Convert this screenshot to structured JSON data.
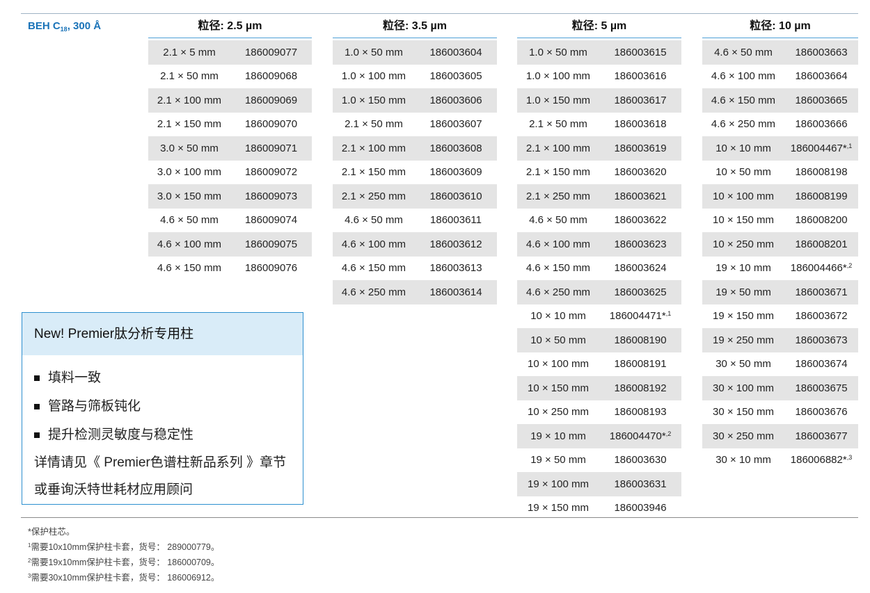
{
  "series": {
    "prefix": "BEH C",
    "sub": "18",
    "suffix": ", 300 Å"
  },
  "columns": [
    {
      "header": "粒径: 2.5 µm",
      "rows": [
        {
          "dim": "2.1 × 5 mm",
          "pn": "186009077",
          "note": ""
        },
        {
          "dim": "2.1 × 50 mm",
          "pn": "186009068",
          "note": ""
        },
        {
          "dim": "2.1 × 100 mm",
          "pn": "186009069",
          "note": ""
        },
        {
          "dim": "2.1 × 150 mm",
          "pn": "186009070",
          "note": ""
        },
        {
          "dim": "3.0 × 50 mm",
          "pn": "186009071",
          "note": ""
        },
        {
          "dim": "3.0 × 100 mm",
          "pn": "186009072",
          "note": ""
        },
        {
          "dim": "3.0 × 150 mm",
          "pn": "186009073",
          "note": ""
        },
        {
          "dim": "4.6 × 50 mm",
          "pn": "186009074",
          "note": ""
        },
        {
          "dim": "4.6 × 100 mm",
          "pn": "186009075",
          "note": ""
        },
        {
          "dim": "4.6 × 150 mm",
          "pn": "186009076",
          "note": ""
        }
      ]
    },
    {
      "header": "粒径: 3.5 µm",
      "rows": [
        {
          "dim": "1.0 × 50 mm",
          "pn": "186003604",
          "note": ""
        },
        {
          "dim": "1.0 × 100 mm",
          "pn": "186003605",
          "note": ""
        },
        {
          "dim": "1.0 × 150 mm",
          "pn": "186003606",
          "note": ""
        },
        {
          "dim": "2.1 × 50 mm",
          "pn": "186003607",
          "note": ""
        },
        {
          "dim": "2.1 × 100 mm",
          "pn": "186003608",
          "note": ""
        },
        {
          "dim": "2.1 × 150 mm",
          "pn": "186003609",
          "note": ""
        },
        {
          "dim": "2.1 × 250 mm",
          "pn": "186003610",
          "note": ""
        },
        {
          "dim": "4.6 × 50 mm",
          "pn": "186003611",
          "note": ""
        },
        {
          "dim": "4.6 × 100 mm",
          "pn": "186003612",
          "note": ""
        },
        {
          "dim": "4.6 × 150 mm",
          "pn": "186003613",
          "note": ""
        },
        {
          "dim": "4.6 × 250 mm",
          "pn": "186003614",
          "note": ""
        }
      ]
    },
    {
      "header": "粒径: 5 µm",
      "rows": [
        {
          "dim": "1.0 × 50 mm",
          "pn": "186003615",
          "note": ""
        },
        {
          "dim": "1.0 × 100 mm",
          "pn": "186003616",
          "note": ""
        },
        {
          "dim": "1.0 × 150 mm",
          "pn": "186003617",
          "note": ""
        },
        {
          "dim": "2.1 × 50 mm",
          "pn": "186003618",
          "note": ""
        },
        {
          "dim": "2.1 × 100 mm",
          "pn": "186003619",
          "note": ""
        },
        {
          "dim": "2.1 × 150 mm",
          "pn": "186003620",
          "note": ""
        },
        {
          "dim": "2.1 × 250 mm",
          "pn": "186003621",
          "note": ""
        },
        {
          "dim": "4.6 × 50 mm",
          "pn": "186003622",
          "note": ""
        },
        {
          "dim": "4.6 × 100 mm",
          "pn": "186003623",
          "note": ""
        },
        {
          "dim": "4.6 × 150 mm",
          "pn": "186003624",
          "note": ""
        },
        {
          "dim": "4.6 × 250 mm",
          "pn": "186003625",
          "note": ""
        },
        {
          "dim": "10 × 10 mm",
          "pn": "186004471*",
          "note": ",1"
        },
        {
          "dim": "10 × 50 mm",
          "pn": "186008190",
          "note": ""
        },
        {
          "dim": "10 × 100 mm",
          "pn": "186008191",
          "note": ""
        },
        {
          "dim": "10 × 150 mm",
          "pn": "186008192",
          "note": ""
        },
        {
          "dim": "10 × 250 mm",
          "pn": "186008193",
          "note": ""
        },
        {
          "dim": "19 × 10 mm",
          "pn": "186004470*",
          "note": ",2"
        },
        {
          "dim": "19 × 50 mm",
          "pn": "186003630",
          "note": ""
        },
        {
          "dim": "19 × 100 mm",
          "pn": "186003631",
          "note": ""
        },
        {
          "dim": "19 × 150 mm",
          "pn": "186003946",
          "note": ""
        }
      ]
    },
    {
      "header": "粒径: 10 µm",
      "rows": [
        {
          "dim": "4.6 × 50 mm",
          "pn": "186003663",
          "note": ""
        },
        {
          "dim": "4.6 × 100 mm",
          "pn": "186003664",
          "note": ""
        },
        {
          "dim": "4.6 × 150 mm",
          "pn": "186003665",
          "note": ""
        },
        {
          "dim": "4.6 × 250 mm",
          "pn": "186003666",
          "note": ""
        },
        {
          "dim": "10 × 10 mm",
          "pn": "186004467*",
          "note": ",1"
        },
        {
          "dim": "10 × 50 mm",
          "pn": "186008198",
          "note": ""
        },
        {
          "dim": "10 × 100 mm",
          "pn": "186008199",
          "note": ""
        },
        {
          "dim": "10 × 150 mm",
          "pn": "186008200",
          "note": ""
        },
        {
          "dim": "10 × 250 mm",
          "pn": "186008201",
          "note": ""
        },
        {
          "dim": "19 × 10 mm",
          "pn": "186004466*",
          "note": ",2"
        },
        {
          "dim": "19 × 50 mm",
          "pn": "186003671",
          "note": ""
        },
        {
          "dim": "19 × 150 mm",
          "pn": "186003672",
          "note": ""
        },
        {
          "dim": "19 × 250 mm",
          "pn": "186003673",
          "note": ""
        },
        {
          "dim": "30 × 50 mm",
          "pn": "186003674",
          "note": ""
        },
        {
          "dim": "30 × 100 mm",
          "pn": "186003675",
          "note": ""
        },
        {
          "dim": "30 × 150 mm",
          "pn": "186003676",
          "note": ""
        },
        {
          "dim": "30 × 250 mm",
          "pn": "186003677",
          "note": ""
        },
        {
          "dim": "30 × 10 mm",
          "pn": "186006882*",
          "note": ",3"
        }
      ]
    }
  ],
  "promo": {
    "title": "New!  Premier肽分析专用柱",
    "bullets": [
      "填料一致",
      "管路与筛板钝化",
      "提升检测灵敏度与稳定性"
    ],
    "lines": [
      "详情请见《 Premier色谱柱新品系列 》章节",
      "或垂询沃特世耗材应用顾问"
    ]
  },
  "footnotes": [
    {
      "mark": "",
      "text": "*保护柱芯。"
    },
    {
      "mark": "1",
      "text": "需要10x10mm保护柱卡套，货号： 289000779。"
    },
    {
      "mark": "2",
      "text": "需要19x10mm保护柱卡套，货号： 186000709。"
    },
    {
      "mark": "3",
      "text": "需要30x10mm保护柱卡套，货号： 186006912。"
    }
  ],
  "colors": {
    "accent": "#1a73b8",
    "rule": "#4d9fd6",
    "shade": "#e4e4e4",
    "promo_bg": "#d9ecf8"
  }
}
